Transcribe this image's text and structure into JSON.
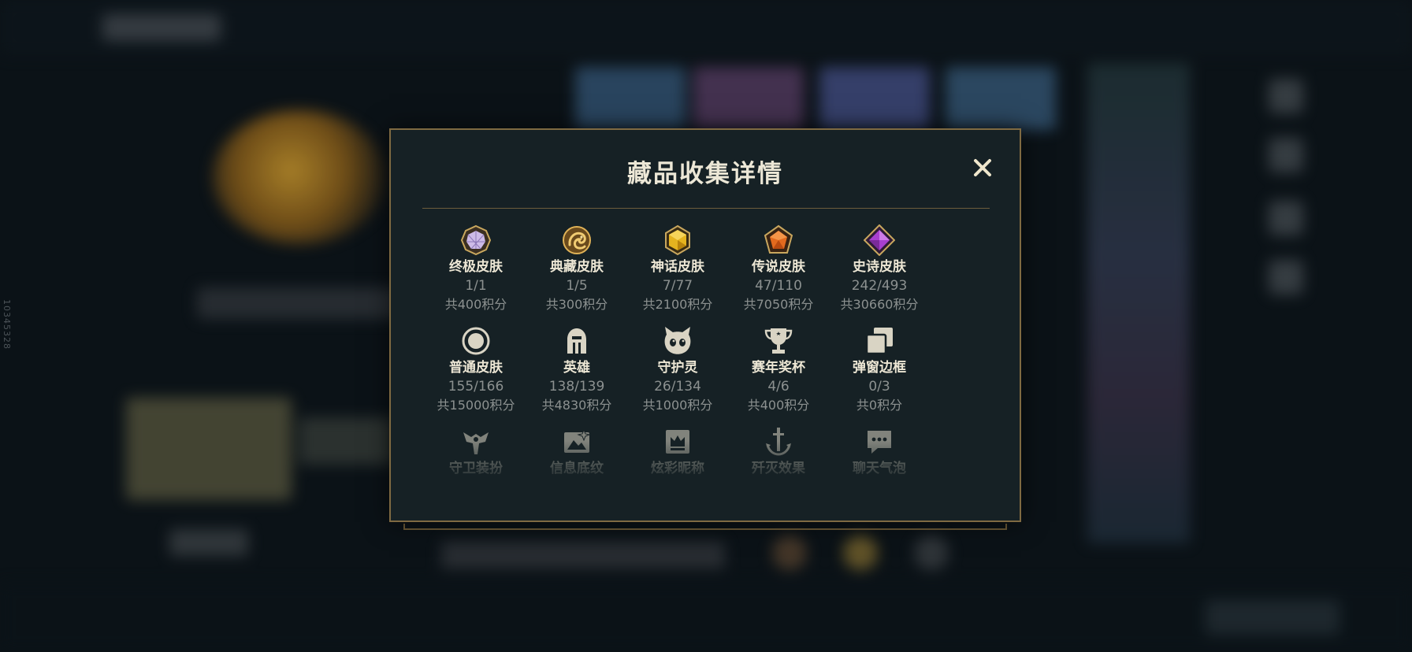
{
  "modal": {
    "title": "藏品收集详情",
    "close_label": "✕"
  },
  "side_id": "10345328",
  "items": [
    {
      "name": "终极皮肤",
      "count": "1/1",
      "points": "共400积分",
      "icon": "ultimate-gem-icon",
      "color": "#c9b8e8"
    },
    {
      "name": "典藏皮肤",
      "count": "1/5",
      "points": "共300积分",
      "icon": "prestige-dragon-icon",
      "color": "#d1a14a"
    },
    {
      "name": "神话皮肤",
      "count": "7/77",
      "points": "共2100积分",
      "icon": "mythic-gem-icon",
      "color": "#e3b21f"
    },
    {
      "name": "传说皮肤",
      "count": "47/110",
      "points": "共7050积分",
      "icon": "legendary-gem-icon",
      "color": "#e36a1e"
    },
    {
      "name": "史诗皮肤",
      "count": "242/493",
      "points": "共30660积分",
      "icon": "epic-gem-icon",
      "color": "#b044d6"
    },
    {
      "name": "普通皮肤",
      "count": "155/166",
      "points": "共15000积分",
      "icon": "standard-circle-icon",
      "color": "#d9d4c4"
    },
    {
      "name": "英雄",
      "count": "138/139",
      "points": "共4830积分",
      "icon": "helmet-icon",
      "color": "#d9d4c4"
    },
    {
      "name": "守护灵",
      "count": "26/134",
      "points": "共1000积分",
      "icon": "guardian-face-icon",
      "color": "#d9d4c4"
    },
    {
      "name": "赛年奖杯",
      "count": "4/6",
      "points": "共400积分",
      "icon": "trophy-icon",
      "color": "#d9d4c4"
    },
    {
      "name": "弹窗边框",
      "count": "0/3",
      "points": "共0积分",
      "icon": "frames-icon",
      "color": "#d9d4c4"
    },
    {
      "name": "守卫装扮",
      "count": "",
      "points": "",
      "icon": "ward-icon",
      "color": "#d9d4c4"
    },
    {
      "name": "信息底纹",
      "count": "",
      "points": "",
      "icon": "banner-image-icon",
      "color": "#d9d4c4"
    },
    {
      "name": "炫彩昵称",
      "count": "",
      "points": "",
      "icon": "crown-card-icon",
      "color": "#d9d4c4"
    },
    {
      "name": "歼灭效果",
      "count": "",
      "points": "",
      "icon": "anchor-sword-icon",
      "color": "#d9d4c4"
    },
    {
      "name": "聊天气泡",
      "count": "",
      "points": "",
      "icon": "chat-bubble-icon",
      "color": "#d9d4c4"
    }
  ]
}
